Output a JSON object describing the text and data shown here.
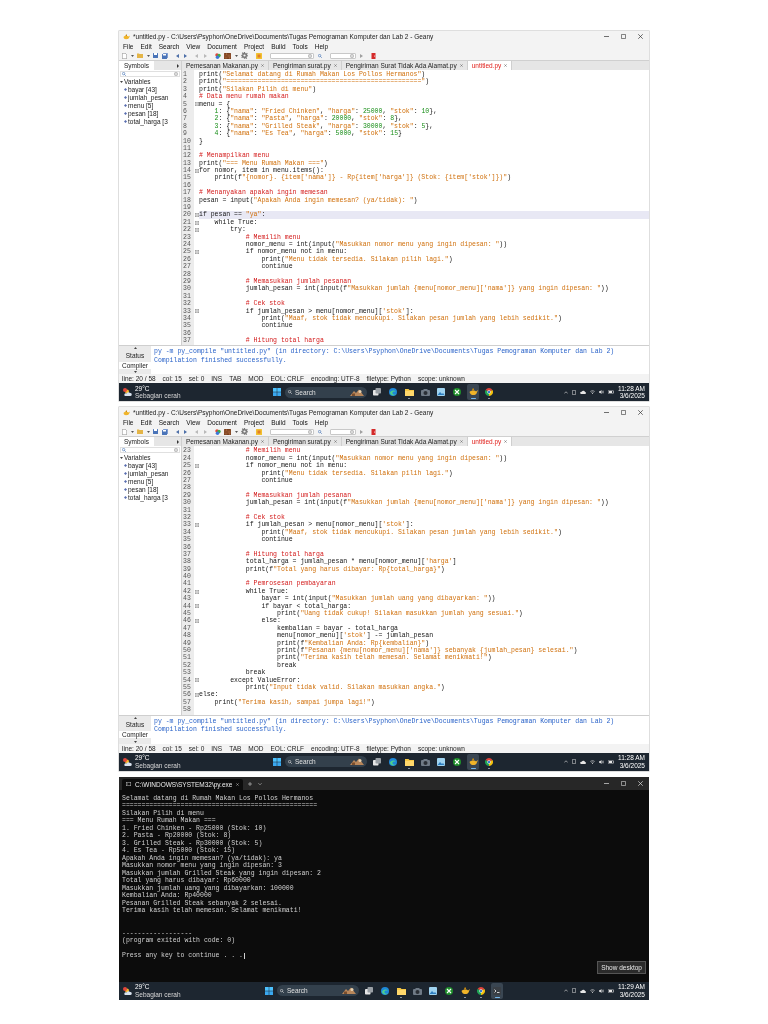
{
  "screenshots": [
    {
      "kind": "geany",
      "window": {
        "title": "*untitled.py - C:\\Users\\Psyphon\\OneDrive\\Documents\\Tugas Pemograman Komputer dan Lab 2 - Geany"
      },
      "menu": [
        "File",
        "Edit",
        "Search",
        "View",
        "Document",
        "Project",
        "Build",
        "Tools",
        "Help"
      ],
      "sidebar": {
        "tab": "Symbols",
        "tree": [
          {
            "label": "Variables",
            "expanded": true,
            "children": [
              {
                "label": "bayar [43]"
              },
              {
                "label": "jumlah_pesan"
              },
              {
                "label": "menu [5]"
              },
              {
                "label": "pesan [18]"
              },
              {
                "label": "total_harga [3"
              }
            ]
          }
        ]
      },
      "tabs": [
        {
          "label": "Pemesanan Makanan.py",
          "selected": false,
          "modified": false
        },
        {
          "label": "Pengiriman surat.py",
          "selected": false,
          "modified": false
        },
        {
          "label": "Pengiriman Surat Tidak Ada Alamat.py",
          "selected": false,
          "modified": false
        },
        {
          "label": "untitled.py",
          "selected": true,
          "modified": true
        }
      ],
      "editor": {
        "lines": [
          {
            "number": "1",
            "text": "print(\"Selamat datang di Rumah Makan Los Pollos Hermanos\")",
            "fold": false,
            "current": false
          },
          {
            "number": "2",
            "text": "print(\"==================================================\")",
            "fold": false,
            "current": false
          },
          {
            "number": "3",
            "text": "print(\"Silakan Pilih di menu\")",
            "fold": false,
            "current": false
          },
          {
            "number": "4",
            "text": "# Data menu rumah makan",
            "fold": false,
            "current": false
          },
          {
            "number": "5",
            "text": "menu = {",
            "fold": true,
            "current": false
          },
          {
            "number": "6",
            "text": "    1: {\"nama\": \"Fried Chinken\", \"harga\": 25000, \"stok\": 10},",
            "fold": false,
            "current": false
          },
          {
            "number": "7",
            "text": "    2: {\"nama\": \"Pasta\", \"harga\": 20000, \"stok\": 8},",
            "fold": false,
            "current": false
          },
          {
            "number": "8",
            "text": "    3: {\"nama\": \"Grilled Steak\", \"harga\": 30000, \"stok\": 5},",
            "fold": false,
            "current": false
          },
          {
            "number": "9",
            "text": "    4: {\"nama\": \"Es Tea\", \"harga\": 5000, \"stok\": 15}",
            "fold": false,
            "current": false
          },
          {
            "number": "10",
            "text": "}",
            "fold": false,
            "current": false
          },
          {
            "number": "11",
            "fold": false,
            "current": false
          },
          {
            "number": "12",
            "text": "# Menampilkan menu",
            "fold": false,
            "current": false
          },
          {
            "number": "13",
            "text": "print(\"=== Menu Rumah Makan ===\")",
            "fold": false,
            "current": false
          },
          {
            "number": "14",
            "text": "for nomor, item in menu.items():",
            "fold": true,
            "current": false
          },
          {
            "number": "15",
            "text": "    print(f\"{nomor}. {item['nama']} - Rp{item['harga']} (Stok: {item['stok']})\")",
            "fold": false,
            "current": false
          },
          {
            "number": "16",
            "fold": false,
            "current": false
          },
          {
            "number": "17",
            "text": "# Menanyakan apakah ingin memesan",
            "fold": false,
            "current": false
          },
          {
            "number": "18",
            "text": "pesan = input(\"Apakah Anda ingin memesan? (ya/tidak): \")",
            "fold": false,
            "current": false
          },
          {
            "number": "19",
            "fold": false,
            "current": false
          },
          {
            "number": "20",
            "text": "if pesan == \"ya\":",
            "fold": true,
            "current": true
          },
          {
            "number": "21",
            "text": "    while True:",
            "fold": true,
            "current": false
          },
          {
            "number": "22",
            "text": "        try:",
            "fold": true,
            "current": false
          },
          {
            "number": "23",
            "text": "            # Memilih menu",
            "fold": false,
            "current": false
          },
          {
            "number": "24",
            "text": "            nomor_menu = int(input(\"Masukkan nomor menu yang ingin dipesan: \"))",
            "fold": false,
            "current": false
          },
          {
            "number": "25",
            "text": "            if nomor_menu not in menu:",
            "fold": true,
            "current": false
          },
          {
            "number": "26",
            "text": "                print(\"Menu tidak tersedia. Silakan pilih lagi.\")",
            "fold": false,
            "current": false
          },
          {
            "number": "27",
            "text": "                continue",
            "fold": false,
            "current": false
          },
          {
            "number": "28",
            "fold": false,
            "current": false
          },
          {
            "number": "29",
            "text": "            # Memasukkan jumlah pesanan",
            "fold": false,
            "current": false
          },
          {
            "number": "30",
            "text": "            jumlah_pesan = int(input(f\"Masukkan jumlah {menu[nomor_menu]['nama']} yang ingin dipesan: \"))",
            "fold": false,
            "current": false
          },
          {
            "number": "31",
            "fold": false,
            "current": false
          },
          {
            "number": "32",
            "text": "            # Cek stok",
            "fold": false,
            "current": false
          },
          {
            "number": "33",
            "text": "            if jumlah_pesan > menu[nomor_menu]['stok']:",
            "fold": true,
            "current": false
          },
          {
            "number": "34",
            "text": "                print(\"Maaf, stok tidak mencukupi. Silakan pesan jumlah yang lebih sedikit.\")",
            "fold": false,
            "current": false
          },
          {
            "number": "35",
            "text": "                continue",
            "fold": false,
            "current": false
          },
          {
            "number": "36",
            "fold": false,
            "current": false
          },
          {
            "number": "37",
            "text": "            # Hitung total harga",
            "fold": false,
            "current": false
          }
        ]
      },
      "messages": {
        "tabs": [
          {
            "label": "Status",
            "selected": false
          },
          {
            "label": "Compiler",
            "selected": true
          }
        ],
        "lines": [
          "py -m py_compile \"untitled.py\" (in directory: C:\\Users\\Psyphon\\OneDrive\\Documents\\Tugas Pemograman Komputer dan Lab 2)",
          "Compilation finished successfully."
        ]
      },
      "status_bar": [
        "line: 20 / 58",
        "col: 15",
        "sel: 0",
        "INS",
        "TAB",
        "MOD",
        "EOL: CRLF",
        "encoding: UTF-8",
        "filetype: Python",
        "scope: unknown"
      ],
      "taskbar": {
        "weather": {
          "temperature": "29°C",
          "condition": "Sebagian cerah"
        },
        "search": {
          "placeholder": "Search"
        },
        "apps": [
          {
            "kind": "taskview",
            "running": false,
            "selected": false
          },
          {
            "kind": "edge",
            "running": false,
            "selected": false
          },
          {
            "kind": "explorer",
            "running": true,
            "selected": false
          },
          {
            "kind": "camera",
            "running": false,
            "selected": false
          },
          {
            "kind": "picture",
            "running": false,
            "selected": false
          },
          {
            "kind": "xbox",
            "running": false,
            "selected": false
          },
          {
            "kind": "geany",
            "running": true,
            "selected": true
          },
          {
            "kind": "chrome",
            "running": true,
            "selected": false
          }
        ],
        "time": "11:28 AM",
        "date": "3/6/2025"
      }
    },
    {
      "kind": "geany",
      "window": {
        "title": "*untitled.py - C:\\Users\\Psyphon\\OneDrive\\Documents\\Tugas Pemograman Komputer dan Lab 2 - Geany"
      },
      "menu": [
        "File",
        "Edit",
        "Search",
        "View",
        "Document",
        "Project",
        "Build",
        "Tools",
        "Help"
      ],
      "sidebar": {
        "tab": "Symbols",
        "tree": [
          {
            "label": "Variables",
            "expanded": true,
            "children": [
              {
                "label": "bayar [43]"
              },
              {
                "label": "jumlah_pesan"
              },
              {
                "label": "menu [5]"
              },
              {
                "label": "pesan [18]"
              },
              {
                "label": "total_harga [3"
              }
            ]
          }
        ]
      },
      "tabs": [
        {
          "label": "Pemesanan Makanan.py",
          "selected": false,
          "modified": false
        },
        {
          "label": "Pengiriman surat.py",
          "selected": false,
          "modified": false
        },
        {
          "label": "Pengiriman Surat Tidak Ada Alamat.py",
          "selected": false,
          "modified": false
        },
        {
          "label": "untitled.py",
          "selected": true,
          "modified": true
        }
      ],
      "editor": {
        "lines": [
          {
            "number": "23",
            "text": "            # Memilih menu",
            "fold": false,
            "current": false
          },
          {
            "number": "24",
            "text": "            nomor_menu = int(input(\"Masukkan nomor menu yang ingin dipesan: \"))",
            "fold": false,
            "current": false
          },
          {
            "number": "25",
            "text": "            if nomor_menu not in menu:",
            "fold": true,
            "current": false
          },
          {
            "number": "26",
            "text": "                print(\"Menu tidak tersedia. Silakan pilih lagi.\")",
            "fold": false,
            "current": false
          },
          {
            "number": "27",
            "text": "                continue",
            "fold": false,
            "current": false
          },
          {
            "number": "28",
            "fold": false,
            "current": false
          },
          {
            "number": "29",
            "text": "            # Memasukkan jumlah pesanan",
            "fold": false,
            "current": false
          },
          {
            "number": "30",
            "text": "            jumlah_pesan = int(input(f\"Masukkan jumlah {menu[nomor_menu]['nama']} yang ingin dipesan: \"))",
            "fold": false,
            "current": false
          },
          {
            "number": "31",
            "fold": false,
            "current": false
          },
          {
            "number": "32",
            "text": "            # Cek stok",
            "fold": false,
            "current": false
          },
          {
            "number": "33",
            "text": "            if jumlah_pesan > menu[nomor_menu]['stok']:",
            "fold": true,
            "current": false
          },
          {
            "number": "34",
            "text": "                print(\"Maaf, stok tidak mencukupi. Silakan pesan jumlah yang lebih sedikit.\")",
            "fold": false,
            "current": false
          },
          {
            "number": "35",
            "text": "                continue",
            "fold": false,
            "current": false
          },
          {
            "number": "36",
            "fold": false,
            "current": false
          },
          {
            "number": "37",
            "text": "            # Hitung total harga",
            "fold": false,
            "current": false
          },
          {
            "number": "38",
            "text": "            total_harga = jumlah_pesan * menu[nomor_menu]['harga']",
            "fold": false,
            "current": false
          },
          {
            "number": "39",
            "text": "            print(f\"Total yang harus dibayar: Rp{total_harga}\")",
            "fold": false,
            "current": false
          },
          {
            "number": "40",
            "fold": false,
            "current": false
          },
          {
            "number": "41",
            "text": "            # Pemrosesan pembayaran",
            "fold": false,
            "current": false
          },
          {
            "number": "42",
            "text": "            while True:",
            "fold": true,
            "current": false
          },
          {
            "number": "43",
            "text": "                bayar = int(input(\"Masukkan jumlah uang yang dibayarkan: \"))",
            "fold": false,
            "current": false
          },
          {
            "number": "44",
            "text": "                if bayar < total_harga:",
            "fold": true,
            "current": false
          },
          {
            "number": "45",
            "text": "                    print(\"Uang tidak cukup! Silakan masukkan jumlah yang sesuai.\")",
            "fold": false,
            "current": false
          },
          {
            "number": "46",
            "text": "                else:",
            "fold": true,
            "current": false
          },
          {
            "number": "47",
            "text": "                    kembalian = bayar - total_harga",
            "fold": false,
            "current": false
          },
          {
            "number": "48",
            "text": "                    menu[nomor_menu]['stok'] -= jumlah_pesan",
            "fold": false,
            "current": false
          },
          {
            "number": "49",
            "text": "                    print(f\"Kembalian Anda: Rp{kembalian}\")",
            "fold": false,
            "current": false
          },
          {
            "number": "50",
            "text": "                    print(f\"Pesanan {menu[nomor_menu]['nama']} sebanyak {jumlah_pesan} selesai.\")",
            "fold": false,
            "current": false
          },
          {
            "number": "51",
            "text": "                    print(\"Terima kasih telah memesan. Selamat menikmati!\")",
            "fold": false,
            "current": false
          },
          {
            "number": "52",
            "text": "                    break",
            "fold": false,
            "current": false
          },
          {
            "number": "53",
            "text": "            break",
            "fold": false,
            "current": false
          },
          {
            "number": "54",
            "text": "        except ValueError:",
            "fold": true,
            "current": false
          },
          {
            "number": "55",
            "text": "            print(\"Input tidak valid. Silakan masukkan angka.\")",
            "fold": false,
            "current": false
          },
          {
            "number": "56",
            "text": "else:",
            "fold": true,
            "current": false
          },
          {
            "number": "57",
            "text": "    print(\"Terima kasih, sampai jumpa lagi!\")",
            "fold": false,
            "current": false
          },
          {
            "number": "58",
            "fold": false,
            "current": false
          }
        ]
      },
      "messages": {
        "tabs": [
          {
            "label": "Status",
            "selected": false
          },
          {
            "label": "Compiler",
            "selected": true
          }
        ],
        "lines": [
          "py -m py_compile \"untitled.py\" (in directory: C:\\Users\\Psyphon\\OneDrive\\Documents\\Tugas Pemograman Komputer dan Lab 2)",
          "Compilation finished successfully."
        ]
      },
      "status_bar": [
        "line: 20 / 58",
        "col: 15",
        "sel: 0",
        "INS",
        "TAB",
        "MOD",
        "EOL: CRLF",
        "encoding: UTF-8",
        "filetype: Python",
        "scope: unknown"
      ],
      "taskbar": {
        "weather": {
          "temperature": "29°C",
          "condition": "Sebagian cerah"
        },
        "search": {
          "placeholder": "Search"
        },
        "apps": [
          {
            "kind": "taskview",
            "running": false,
            "selected": false
          },
          {
            "kind": "edge",
            "running": false,
            "selected": false
          },
          {
            "kind": "explorer",
            "running": true,
            "selected": false
          },
          {
            "kind": "camera",
            "running": false,
            "selected": false
          },
          {
            "kind": "picture",
            "running": false,
            "selected": false
          },
          {
            "kind": "xbox",
            "running": false,
            "selected": false
          },
          {
            "kind": "geany",
            "running": true,
            "selected": true
          },
          {
            "kind": "chrome",
            "running": true,
            "selected": false
          }
        ],
        "time": "11:28 AM",
        "date": "3/6/2025"
      }
    },
    {
      "kind": "terminal",
      "tab": {
        "title": "C:\\WINDOWS\\SYSTEM32\\py.exe"
      },
      "output": [
        [
          "Selamat datang di Rumah Makan Los Pollos Hermanos",
          "==================================================",
          "Silakan Pilih di menu",
          "=== Menu Rumah Makan ===",
          "1. Fried Chinken - Rp25000 (Stok: 10)",
          "2. Pasta - Rp20000 (Stok: 8)",
          "3. Grilled Steak - Rp30000 (Stok: 5)",
          "4. Es Tea - Rp5000 (Stok: 15)",
          "Apakah Anda ingin memesan? (ya/tidak): ya",
          "Masukkan nomor menu yang ingin dipesan: 3",
          "Masukkan jumlah Grilled Steak yang ingin dipesan: 2",
          "Total yang harus dibayar: Rp60000",
          "Masukkan jumlah uang yang dibayarkan: 100000",
          "Kembalian Anda: Rp40000",
          "Pesanan Grilled Steak sebanyak 2 selesai.",
          "Terima kasih telah memesan. Selamat menikmati!"
        ],
        [
          "------------------",
          "(program exited with code: 0)"
        ],
        [
          "Press any key to continue . . ."
        ]
      ],
      "tooltip": "Show desktop",
      "taskbar": {
        "weather": {
          "temperature": "29°C",
          "condition": "Sebagian cerah"
        },
        "search": {
          "placeholder": "Search"
        },
        "apps": [
          {
            "kind": "taskview",
            "running": false,
            "selected": false
          },
          {
            "kind": "edge",
            "running": false,
            "selected": false
          },
          {
            "kind": "explorer",
            "running": true,
            "selected": false
          },
          {
            "kind": "camera",
            "running": false,
            "selected": false
          },
          {
            "kind": "picture",
            "running": false,
            "selected": false
          },
          {
            "kind": "xbox",
            "running": false,
            "selected": false
          },
          {
            "kind": "geany",
            "running": true,
            "selected": false
          },
          {
            "kind": "chrome",
            "running": true,
            "selected": false
          },
          {
            "kind": "terminal",
            "running": true,
            "selected": true
          }
        ],
        "time": "11:29 AM",
        "date": "3/6/2025"
      }
    }
  ]
}
